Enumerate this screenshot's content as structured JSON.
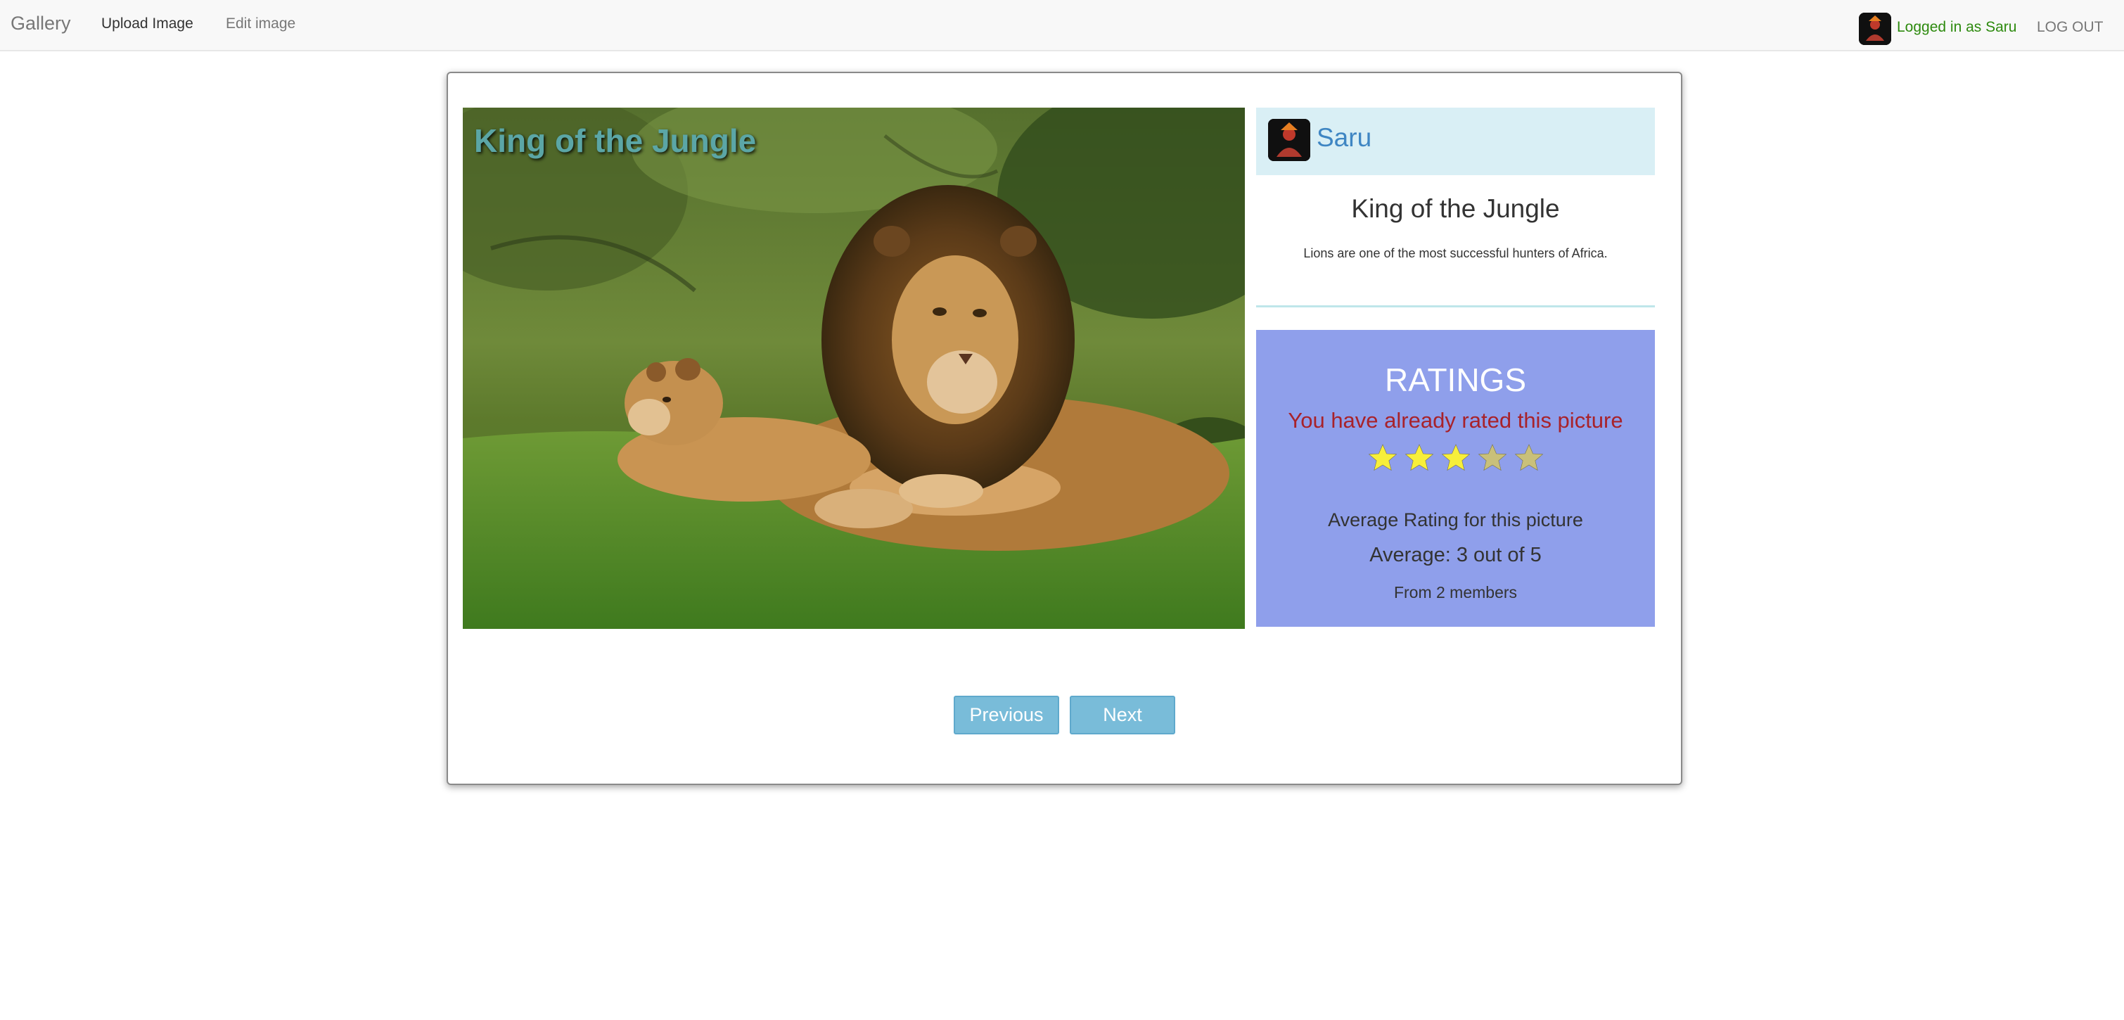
{
  "navbar": {
    "brand": "Gallery",
    "upload_label": "Upload Image",
    "edit_label": "Edit image",
    "logged_in_text": "Logged in as Saru",
    "logout_label": "LOG OUT"
  },
  "picture": {
    "overlay_title": "King of the Jungle",
    "author": "Saru",
    "title": "King of the Jungle",
    "description": "Lions are one of the most successful hunters of Africa."
  },
  "ratings": {
    "heading": "RATINGS",
    "message": "You have already rated this picture",
    "stars_filled": 3,
    "stars_total": 5,
    "average_heading": "Average Rating for this picture",
    "average_text": "Average: 3 out of 5",
    "members_text": "From 2 members"
  },
  "pager": {
    "previous_label": "Previous",
    "next_label": "Next"
  },
  "colors": {
    "ratings_bg": "#8f9feb",
    "author_bg": "#d9eff5",
    "star_filled": "#f7ef3a",
    "star_empty": "#c9c07a",
    "button_bg": "#79bcd9"
  },
  "icons": {
    "nav_avatar": "user-avatar-icon",
    "author_avatar": "user-avatar-icon",
    "star": "star-icon"
  }
}
